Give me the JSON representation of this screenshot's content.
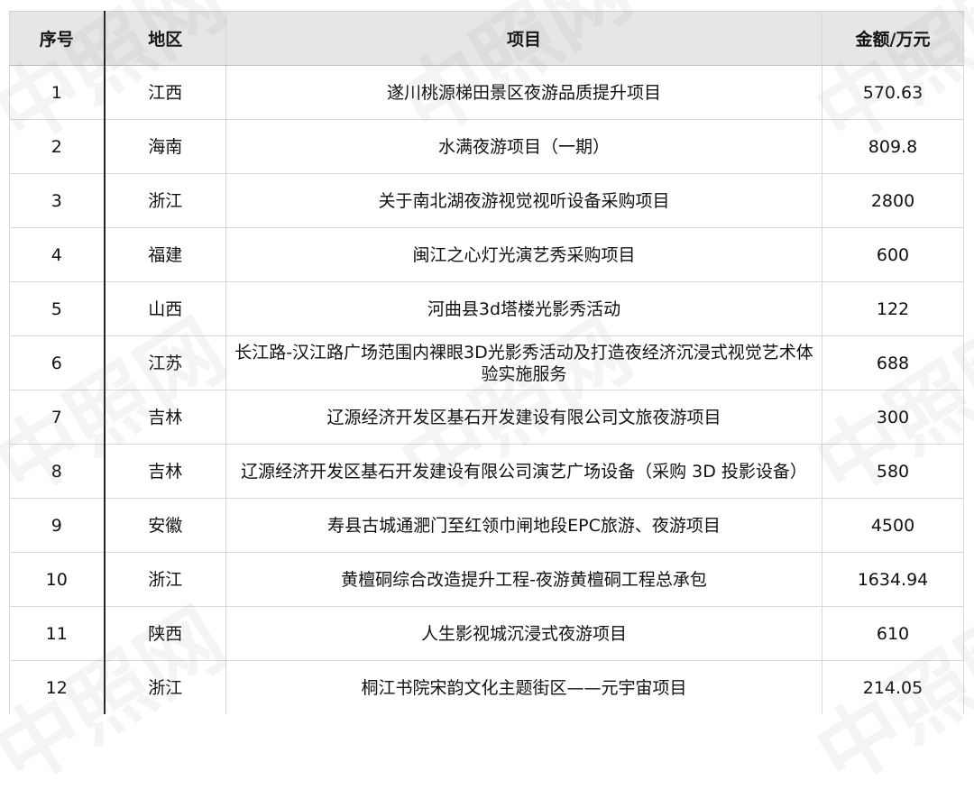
{
  "table": {
    "headers": {
      "no": "序号",
      "region": "地区",
      "project": "项目",
      "amount": "金额/万元"
    },
    "rows": [
      {
        "no": "1",
        "region": "江西",
        "project": "遂川桃源梯田景区夜游品质提升项目",
        "amount": "570.63"
      },
      {
        "no": "2",
        "region": "海南",
        "project": "水满夜游项目（一期）",
        "amount": "809.8"
      },
      {
        "no": "3",
        "region": "浙江",
        "project": "关于南北湖夜游视觉视听设备采购项目",
        "amount": "2800"
      },
      {
        "no": "4",
        "region": "福建",
        "project": "闽江之心灯光演艺秀采购项目",
        "amount": "600"
      },
      {
        "no": "5",
        "region": "山西",
        "project": "河曲县3d塔楼光影秀活动",
        "amount": "122"
      },
      {
        "no": "6",
        "region": "江苏",
        "project": "长江路-汉江路广场范围内裸眼3D光影秀活动及打造夜经济沉浸式视觉艺术体验实施服务",
        "amount": "688"
      },
      {
        "no": "7",
        "region": "吉林",
        "project": "辽源经济开发区基石开发建设有限公司文旅夜游项目",
        "amount": "300"
      },
      {
        "no": "8",
        "region": "吉林",
        "project": "辽源经济开发区基石开发建设有限公司演艺广场设备（采购 3D 投影设备）",
        "amount": "580"
      },
      {
        "no": "9",
        "region": "安徽",
        "project": "寿县古城通淝门至红领巾闸地段EPC旅游、夜游项目",
        "amount": "4500"
      },
      {
        "no": "10",
        "region": "浙江",
        "project": "黄檀硐综合改造提升工程-夜游黄檀硐工程总承包",
        "amount": "1634.94"
      },
      {
        "no": "11",
        "region": "陕西",
        "project": "人生影视城沉浸式夜游项目",
        "amount": "610"
      },
      {
        "no": "12",
        "region": "浙江",
        "project": "桐江书院宋韵文化主题街区——元宇宙项目",
        "amount": "214.05"
      }
    ]
  },
  "watermark": {
    "text": "中照网"
  }
}
